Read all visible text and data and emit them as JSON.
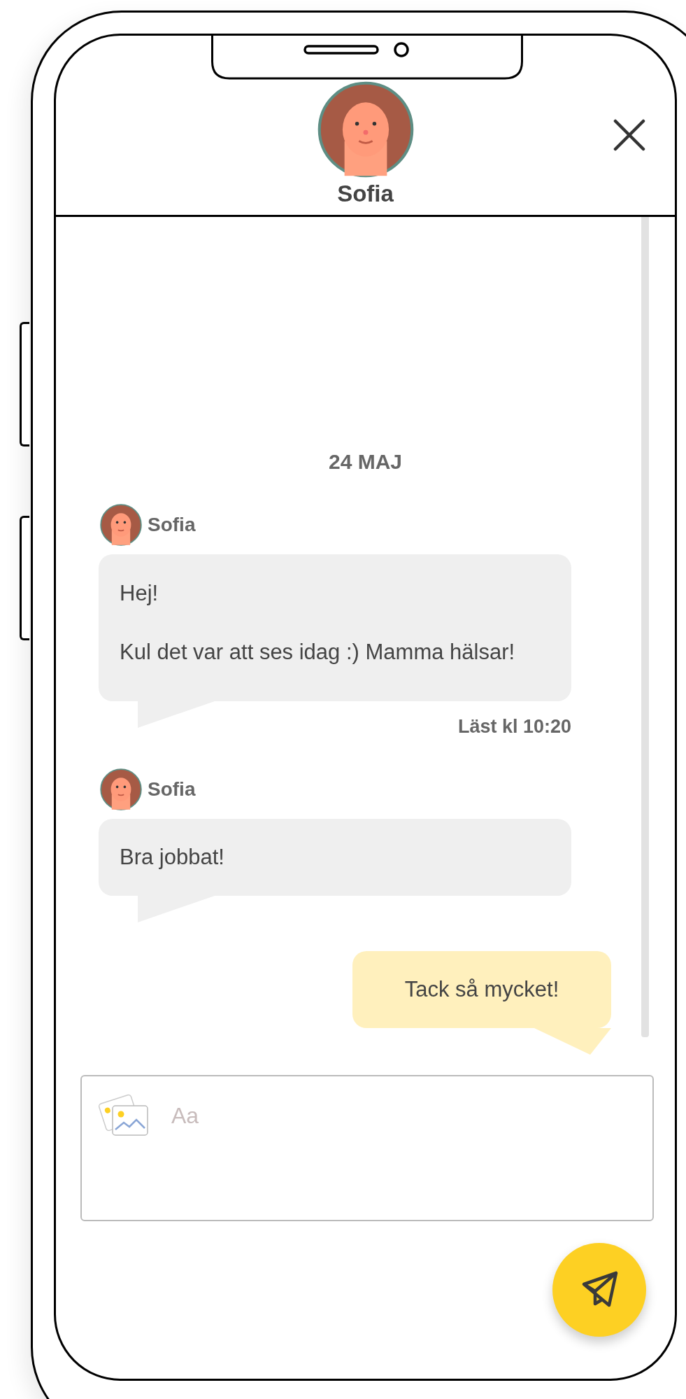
{
  "header": {
    "name": "Sofia"
  },
  "date": "24 MAJ",
  "messages": [
    {
      "kind": "received",
      "sender": "Sofia",
      "paragraphs": [
        "Hej!",
        "Kul det var att ses idag :) Mamma hälsar!"
      ],
      "receipt": "Läst kl 10:20"
    },
    {
      "kind": "received",
      "sender": "Sofia",
      "paragraphs": [
        "Bra jobbat!"
      ]
    },
    {
      "kind": "sent",
      "paragraphs": [
        "Tack så mycket!"
      ]
    }
  ],
  "composer": {
    "placeholder": "Aa"
  }
}
